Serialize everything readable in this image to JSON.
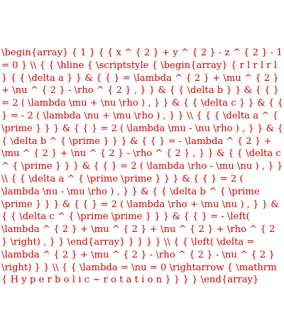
{
  "source": {
    "text": "\\begin{array} { 1 } { { x ^ { 2 } + y ^ { 2 } - z ^ { 2 } - 1 = 0 } \\\\ { { \\hline { \\scriptstyle { \\begin{array} { r l r l r l } { { \\delta a } } & { { } = \\lambda ^ { 2 } + \\mu ^ { 2 } + \\nu ^ { 2 } - \\rho ^ { 2 } , } } & { { \\delta b } } & { { } = 2 ( \\lambda \\mu + \\nu \\rho ) , } } & { { \\delta c } } & { { } = - 2 ( \\lambda \\nu + \\mu \\rho ) , } } \\\\ { { { \\delta a ^ { \\prime } } } & { { } = 2 ( \\lambda \\mu - \\nu \\rho ) , } } & { { \\delta b ^ { \\prime } } } & { { } = - \\lambda ^ { 2 } + \\mu ^ { 2 } + \\nu ^ { 2 } - \\rho ^ { 2 } , } } & { { \\delta c ^ { \\prime } } } & { { } = 2 ( \\lambda \\rho - \\mu \\nu ) , } } \\\\ { { \\delta a ^ { \\prime \\prime } } } & { { } = 2 ( \\lambda \\nu - \\mu \\rho ) , } } & { { \\delta b ^ { \\prime \\prime } } } & { { } = 2 ( \\lambda \\rho + \\mu \\nu ) , } } & { { \\delta c ^ { \\prime \\prime } } } & { { } = - \\left( \\lambda ^ { 2 } + \\mu ^ { 2 } + \\nu ^ { 2 } + \\rho ^ { 2 } \\right) , } } \\end{array} } } } } \\\\ { { \\left( \\delta = \\lambda ^ { 2 } + \\mu ^ { 2 } - \\rho ^ { 2 } - \\nu ^ { 2 } \\right) } } \\\\ { { \\lambda = \\nu = 0 \\rightarrow { \\mathrm { H y p e r b o l i c ~ r o t a t i o n } } } } \\end{array}"
  },
  "colors": {
    "text": "#cc0000",
    "background": "#ffffff"
  }
}
